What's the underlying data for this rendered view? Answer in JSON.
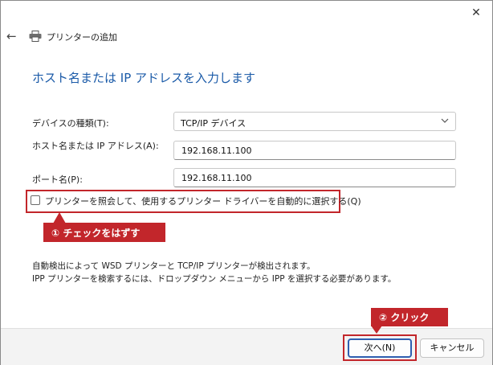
{
  "window": {
    "title": "プリンターの追加",
    "close_glyph": "✕",
    "back_glyph": "←"
  },
  "heading": "ホスト名または IP アドレスを入力します",
  "form": {
    "device_type_label": "デバイスの種類(T):",
    "device_type_value": "TCP/IP デバイス",
    "hostname_label": "ホスト名または IP アドレス(A):",
    "hostname_value": "192.168.11.100",
    "port_label": "ポート名(P):",
    "port_value": "192.168.11.100",
    "checkbox_label": "プリンターを照会して、使用するプリンター ドライバーを自動的に選択する(Q)",
    "checkbox_checked": false
  },
  "annotations": {
    "step1": "① チェックをはずす",
    "step2": "② クリック",
    "color": "#c2262b"
  },
  "info": {
    "line1": "自動検出によって WSD プリンターと TCP/IP プリンターが検出されます。",
    "line2": "IPP プリンターを検索するには、ドロップダウン メニューから IPP を選択する必要があります。"
  },
  "buttons": {
    "next": "次へ(N)",
    "cancel": "キャンセル"
  }
}
